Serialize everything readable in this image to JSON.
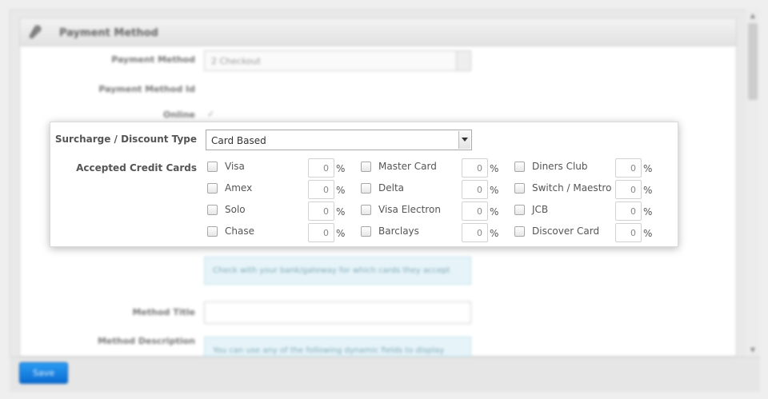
{
  "panel": {
    "title": "Payment Method",
    "fields": {
      "payment_method_label": "Payment Method",
      "payment_method_value": "2 Checkout",
      "payment_method_id_label": "Payment Method Id",
      "online_label": "Online",
      "online_mark": "✓",
      "info_text": "Check with your bank/gateway for which cards they accept",
      "method_title_label": "Method Title",
      "method_description_label": "Method Description",
      "description_info": "You can use any of the following dynamic fields to display"
    }
  },
  "card": {
    "surcharge_label": "Surcharge / Discount Type",
    "surcharge_value": "Card Based",
    "accepted_label": "Accepted Credit Cards",
    "percent_sign": "%",
    "cards": [
      {
        "name": "Visa",
        "pct": "0"
      },
      {
        "name": "Master Card",
        "pct": "0"
      },
      {
        "name": "Diners Club",
        "pct": "0"
      },
      {
        "name": "Amex",
        "pct": "0"
      },
      {
        "name": "Delta",
        "pct": "0"
      },
      {
        "name": "Switch / Maestro",
        "pct": "0"
      },
      {
        "name": "Solo",
        "pct": "0"
      },
      {
        "name": "Visa Electron",
        "pct": "0"
      },
      {
        "name": "JCB",
        "pct": "0"
      },
      {
        "name": "Chase",
        "pct": "0"
      },
      {
        "name": "Barclays",
        "pct": "0"
      },
      {
        "name": "Discover Card",
        "pct": "0"
      }
    ]
  },
  "footer": {
    "save_label": "Save"
  },
  "scrollbar": {
    "up_glyph": "▲",
    "down_glyph": "▼"
  },
  "colors": {
    "save_button": "#1a7fe0",
    "info_bg": "#e6f4f9"
  },
  "icons": {
    "header": "wrench-icon",
    "select_arrow": "chevron-down-icon"
  }
}
